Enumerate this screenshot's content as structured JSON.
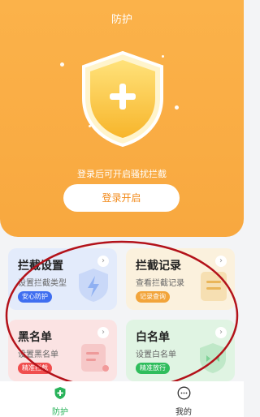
{
  "header": {
    "title": "防护",
    "tip": "登录后可开启骚扰拦截",
    "login_button": "登录开启"
  },
  "cards": [
    {
      "title": "拦截设置",
      "subtitle": "设置拦截类型",
      "tag": "安心防护",
      "arrow": "›"
    },
    {
      "title": "拦截记录",
      "subtitle": "查看拦截记录",
      "tag": "记录查询",
      "arrow": "›"
    },
    {
      "title": "黑名单",
      "subtitle": "设置黑名单",
      "tag": "精准拦截",
      "arrow": "›"
    },
    {
      "title": "白名单",
      "subtitle": "设置白名单",
      "tag": "精准放行",
      "arrow": "›"
    }
  ],
  "tabbar": {
    "items": [
      {
        "label": "防护",
        "icon": "shield-plus-icon",
        "active": true
      },
      {
        "label": "我的",
        "icon": "chat-dots-icon",
        "active": false
      }
    ]
  },
  "colors": {
    "header": "#f9ad44",
    "accent_orange": "#f28b1c",
    "active_tab": "#29b35a",
    "annotation_red": "#b3121a"
  }
}
